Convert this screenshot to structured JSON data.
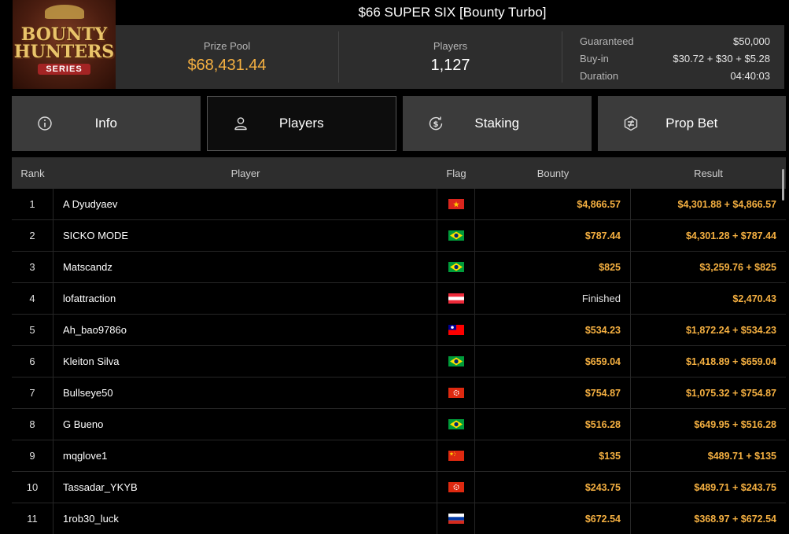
{
  "logo": {
    "line1": "BOUNTY",
    "line2": "HUNTERS",
    "line3": "SERIES"
  },
  "title": "$66 SUPER SIX [Bounty Turbo]",
  "stats": {
    "prize_pool_label": "Prize Pool",
    "prize_pool_value": "$68,431.44",
    "players_label": "Players",
    "players_value": "1,127",
    "details": [
      {
        "label": "Guaranteed",
        "value": "$50,000"
      },
      {
        "label": "Buy-in",
        "value": "$30.72 + $30 + $5.28"
      },
      {
        "label": "Duration",
        "value": "04:40:03"
      }
    ]
  },
  "tabs": [
    {
      "label": "Info",
      "icon": "info-icon"
    },
    {
      "label": "Players",
      "icon": "user-icon"
    },
    {
      "label": "Staking",
      "icon": "dollar-cycle-icon"
    },
    {
      "label": "Prop Bet",
      "icon": "prop-bet-icon"
    }
  ],
  "table": {
    "headers": {
      "rank": "Rank",
      "player": "Player",
      "flag": "Flag",
      "bounty": "Bounty",
      "result": "Result"
    },
    "rows": [
      {
        "rank": "1",
        "player": "A Dyudyaev",
        "flag": "vn",
        "bounty": "$4,866.57",
        "result": "$4,301.88 + $4,866.57"
      },
      {
        "rank": "2",
        "player": "SICKO MODE",
        "flag": "br",
        "bounty": "$787.44",
        "result": "$4,301.28 + $787.44"
      },
      {
        "rank": "3",
        "player": "Matscandz",
        "flag": "br",
        "bounty": "$825",
        "result": "$3,259.76 + $825"
      },
      {
        "rank": "4",
        "player": "lofattraction",
        "flag": "at",
        "bounty": "Finished",
        "result": "$2,470.43"
      },
      {
        "rank": "5",
        "player": "Ah_bao9786o",
        "flag": "tw",
        "bounty": "$534.23",
        "result": "$1,872.24 + $534.23"
      },
      {
        "rank": "6",
        "player": "Kleiton Silva",
        "flag": "br",
        "bounty": "$659.04",
        "result": "$1,418.89 + $659.04"
      },
      {
        "rank": "7",
        "player": "Bullseye50",
        "flag": "hk",
        "bounty": "$754.87",
        "result": "$1,075.32 + $754.87"
      },
      {
        "rank": "8",
        "player": "G Bueno",
        "flag": "br",
        "bounty": "$516.28",
        "result": "$649.95 + $516.28"
      },
      {
        "rank": "9",
        "player": "mqglove1",
        "flag": "cn",
        "bounty": "$135",
        "result": "$489.71 + $135"
      },
      {
        "rank": "10",
        "player": "Tassadar_YKYB",
        "flag": "hk",
        "bounty": "$243.75",
        "result": "$489.71 + $243.75"
      },
      {
        "rank": "11",
        "player": "1rob30_luck",
        "flag": "ru",
        "bounty": "$672.54",
        "result": "$368.97 + $672.54"
      }
    ]
  },
  "colors": {
    "accent_gold": "#f5b041",
    "panel": "#2d2d2d",
    "tab": "#3b3b3b"
  }
}
